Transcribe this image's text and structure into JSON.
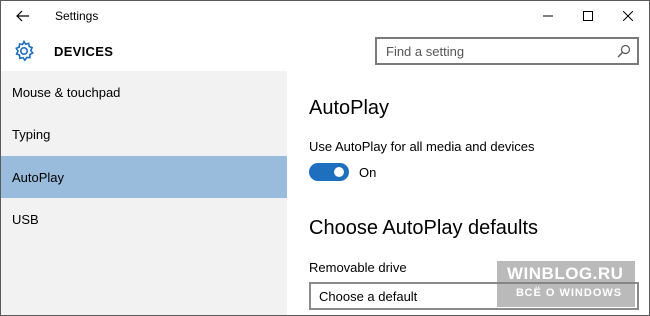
{
  "window": {
    "title": "Settings"
  },
  "header": {
    "section": "DEVICES",
    "search_placeholder": "Find a setting"
  },
  "sidebar": {
    "items": [
      {
        "label": "Mouse & touchpad"
      },
      {
        "label": "Typing"
      },
      {
        "label": "AutoPlay"
      },
      {
        "label": "USB"
      }
    ],
    "active": "AutoPlay"
  },
  "main": {
    "heading": "AutoPlay",
    "toggle_label": "Use AutoPlay for all media and devices",
    "toggle_state": "On",
    "defaults_heading": "Choose AutoPlay defaults",
    "removable_label": "Removable drive",
    "removable_value": "Choose a default"
  },
  "watermark": {
    "title": "WINBLOG.RU",
    "subtitle": "ВСЁ О WINDOWS"
  },
  "colors": {
    "accent": "#1e6fbd",
    "sidebar_active": "#9abcdc",
    "sidebar_bg": "#f2f2f2"
  }
}
